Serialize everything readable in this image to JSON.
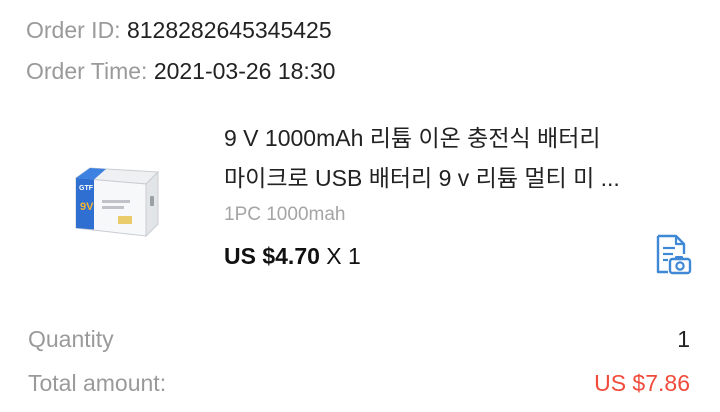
{
  "order": {
    "id_label": "Order ID:",
    "id_value": "8128282645345425",
    "time_label": "Order Time:",
    "time_value": "2021-03-26 18:30"
  },
  "product": {
    "title_line1": "9 V 1000mAh 리튬 이온 충전식 배터리",
    "title_line2": "마이크로 USB 배터리 9 v 리튬 멀티 미 ...",
    "image_brand": "GTF",
    "image_voltage": "9V",
    "variant": "1PC 1000mah",
    "price": "US $4.70",
    "quantity_text": "X 1"
  },
  "summary": {
    "quantity_label": "Quantity",
    "quantity_value": "1",
    "total_label": "Total amount:",
    "total_value": "US $7.86"
  },
  "colors": {
    "label_gray": "#9a9a9a",
    "accent_blue": "#3f88d6",
    "total_red": "#f04b3b"
  },
  "icons": {
    "document_photo": "document-camera-icon"
  }
}
